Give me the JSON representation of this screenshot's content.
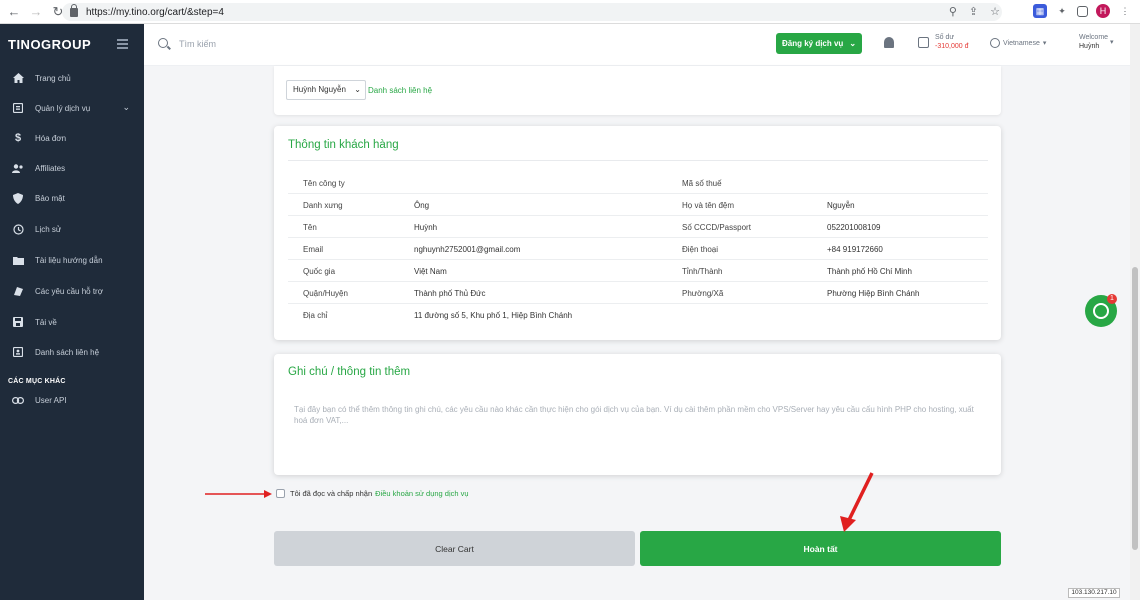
{
  "browser": {
    "url": "https://my.tino.org/cart/&step=4",
    "profile_initial": "H"
  },
  "sidebar": {
    "logo": "TINOGROUP",
    "items": [
      {
        "label": "Trang chủ",
        "icon": "home-icon"
      },
      {
        "label": "Quản lý dịch vụ",
        "icon": "services-icon"
      },
      {
        "label": "Hóa đơn",
        "icon": "dollar-icon"
      },
      {
        "label": "Affiliates",
        "icon": "users-icon"
      },
      {
        "label": "Bảo mật",
        "icon": "shield-icon"
      },
      {
        "label": "Lịch sử",
        "icon": "history-icon"
      },
      {
        "label": "Tài liệu hướng dẫn",
        "icon": "folder-icon"
      },
      {
        "label": "Các yêu cầu hỗ trợ",
        "icon": "support-icon"
      },
      {
        "label": "Tải về",
        "icon": "download-icon"
      },
      {
        "label": "Danh sách liên hệ",
        "icon": "contacts-icon"
      }
    ],
    "section_title": "CÁC MỤC KHÁC",
    "extra_items": [
      {
        "label": "User API",
        "icon": "link-icon"
      }
    ]
  },
  "header": {
    "search_placeholder": "Tìm kiếm",
    "register_button": "Đăng ký dịch vụ",
    "balance_label": "Số dư",
    "balance_value": "-310,000 đ",
    "language": "Vietnamese",
    "welcome": "Welcome",
    "username": "Huỳnh"
  },
  "contact_select": {
    "value": "Huỳnh Nguyễn",
    "link": "Danh sách liên hệ"
  },
  "customer_info": {
    "title": "Thông tin khách hàng",
    "rows": [
      {
        "l1": "Tên công ty",
        "v1": "",
        "l2": "Mã số thuế",
        "v2": ""
      },
      {
        "l1": "Danh xưng",
        "v1": "Ông",
        "l2": "Họ và tên đệm",
        "v2": "Nguyễn"
      },
      {
        "l1": "Tên",
        "v1": "Huỳnh",
        "l2": "Số CCCD/Passport",
        "v2": "052201008109"
      },
      {
        "l1": "Email",
        "v1": "nghuynh2752001@gmail.com",
        "l2": "Điện thoại",
        "v2": "+84 919172660"
      },
      {
        "l1": "Quốc gia",
        "v1": "Việt Nam",
        "l2": "Tỉnh/Thành",
        "v2": "Thành phố Hồ Chí Minh"
      },
      {
        "l1": "Quận/Huyện",
        "v1": "Thành phố Thủ Đức",
        "l2": "Phường/Xã",
        "v2": "Phường Hiệp Bình Chánh"
      },
      {
        "l1": "Địa chỉ",
        "v1": "11 đường số 5, Khu phố 1, Hiệp Bình Chánh",
        "l2": "",
        "v2": ""
      }
    ]
  },
  "notes": {
    "title": "Ghi chú / thông tin thêm",
    "placeholder": "Tại đây bạn có thể thêm thông tin ghi chú, các yêu cầu nào khác cần thực hiện cho gói dịch vụ của bạn. Ví dụ cài thêm phần mềm cho VPS/Server hay yêu cầu cấu hình PHP cho hosting, xuất hoá đơn VAT,..."
  },
  "terms": {
    "text": "Tôi đã đọc và chấp nhận",
    "link": "Điều khoản sử dụng dịch vụ",
    "checked": false
  },
  "actions": {
    "clear": "Clear Cart",
    "finish": "Hoàn tất"
  },
  "chat": {
    "badge": "1"
  },
  "ip": "103.130.217.10",
  "colors": {
    "accent": "#28a745",
    "sidebar_bg": "#1f2b3a",
    "danger": "#e53935"
  }
}
